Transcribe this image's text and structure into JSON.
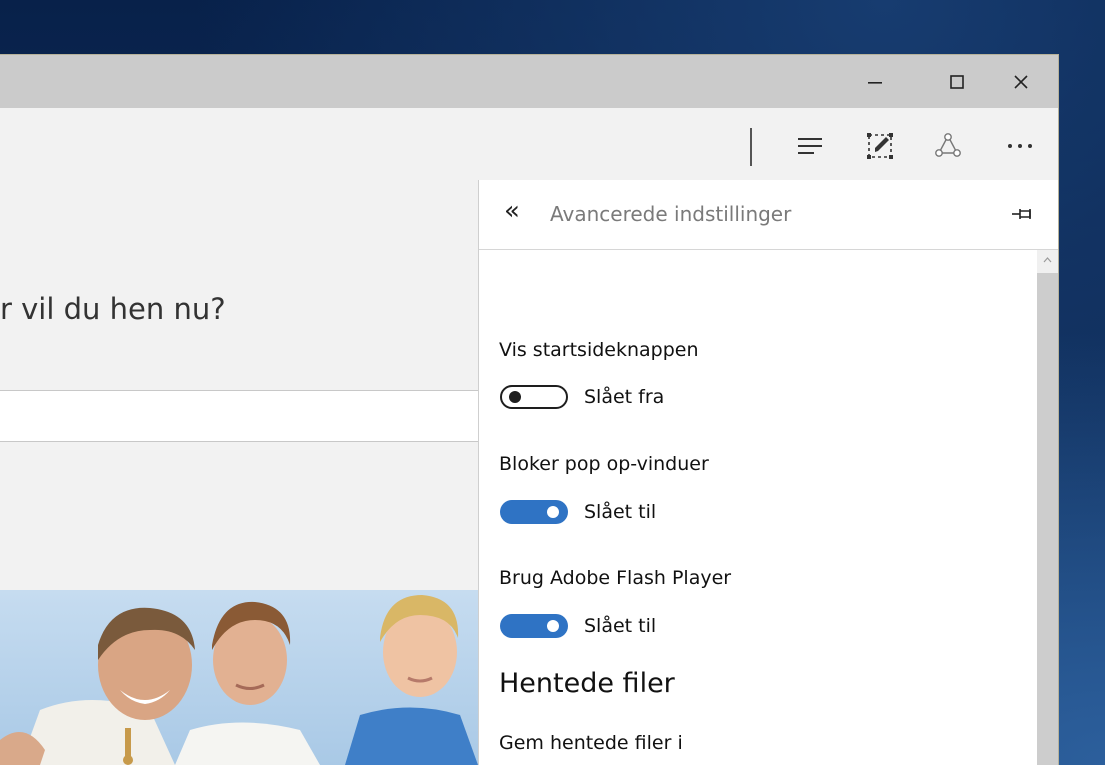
{
  "window_controls": {
    "minimize_icon": "minimize-icon",
    "maximize_icon": "maximize-icon",
    "close_icon": "close-icon"
  },
  "toolbar": {
    "icons": [
      "hub-icon",
      "web-note-icon",
      "share-icon",
      "more-icon"
    ]
  },
  "page": {
    "question_text": "r vil du hen nu?"
  },
  "settings_panel": {
    "title": "Avancerede indstillinger",
    "back_icon": "«",
    "settings": [
      {
        "label": "Vis startsideknappen",
        "state": "Slået fra",
        "on": false
      },
      {
        "label": "Bloker pop op-vinduer",
        "state": "Slået til",
        "on": true
      },
      {
        "label": "Brug Adobe Flash Player",
        "state": "Slået til",
        "on": true
      }
    ],
    "downloads": {
      "heading": "Hentede filer",
      "save_label": "Gem hentede filer i"
    }
  },
  "colors": {
    "toggle_on": "#2f73c4",
    "titlebar": "#cbcbcb",
    "panel_bg": "#ffffff"
  }
}
